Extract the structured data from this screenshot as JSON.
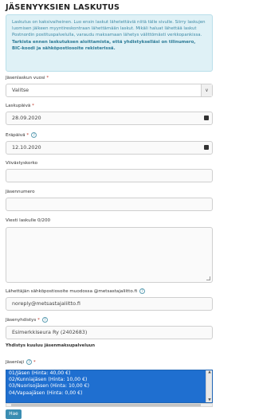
{
  "page_title": "JÄSENYYKSIEN LASKUTUS",
  "info": {
    "text": "Laskutus on kaksivaiheinen. Luo ensin laskut lähetettäviä niitä tälle sivulle. Siirry laskujen luomisen jälkeen myyntireskontraan lähettämään laskut. Mikäli haluat lähettää laskut Postnordin postituspalvelulla, varaudu maksamaan lähetys välittömästi verkkopankissa.",
    "strong": "Tarkista ennen laskutuksen aloittamista, että yhdistykselläsi on tilinumero, BIC-koodi ja sähköpostiosoite rekisterissä."
  },
  "fields": {
    "year": {
      "label": "Jäsenlaskun vuosi",
      "req": "*",
      "value": "Valitse"
    },
    "invoice_date": {
      "label": "Laskupäivä",
      "req": "*",
      "value": "28.09.2020"
    },
    "due_date": {
      "label": "Eräpäivä",
      "req": "*",
      "value": "12.10.2020"
    },
    "delay_interest": {
      "label": "Viivästyskorko"
    },
    "member_number": {
      "label": "Jäsennumero"
    },
    "message": {
      "label": "Viesti laskulle 0/200"
    },
    "sender_email": {
      "label": "Lähettäjän sähköpostiosoite muodossa @metsastajaliitto.fi",
      "value": "noreply@metsastajaliitto.fi"
    },
    "association": {
      "label": "Jäsenyhdistys",
      "req": "*",
      "value": "Esimerkkiseura Ry (2402683)"
    },
    "service_note": "Yhdistys kuuluu jäsenmaksupalveluun",
    "membership": {
      "label": "Jäsenlaji",
      "req": "*",
      "options": [
        "01/Jäsen (Hinta: 40,00 €)",
        "02/Kunniajäsen (Hinta: 10,00 €)",
        "03/Nuorisojäsen (Hinta: 10,00 €)",
        "04/Vapaajäsen (Hinta: 0,00 €)"
      ]
    }
  },
  "search_button": "Hae",
  "icons": {
    "help": "question-circle-icon",
    "calendar": "calendar-icon",
    "dropdown": "chevron-down-icon"
  },
  "colors": {
    "info_bg": "#dff1f6",
    "info_text": "#3d8aa6",
    "listbox_bg": "#1f6fd0",
    "button": "#3a8db2"
  }
}
